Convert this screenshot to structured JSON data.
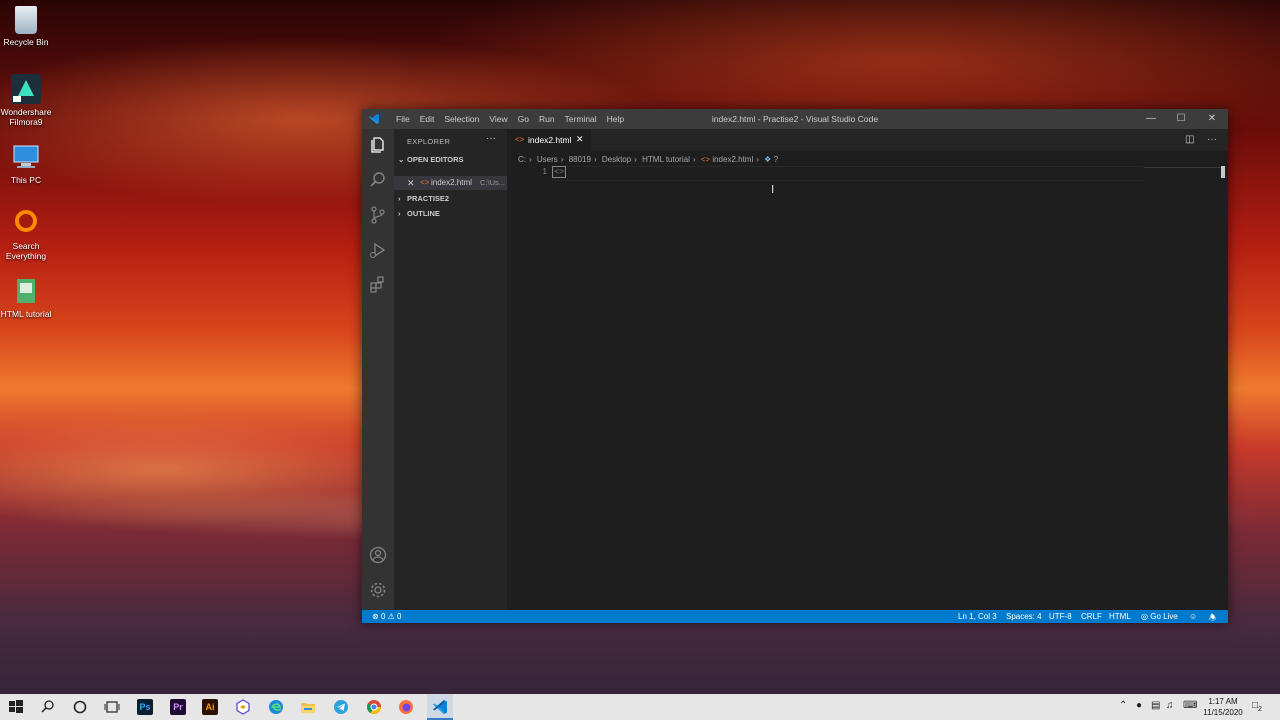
{
  "desktop": {
    "icons": [
      {
        "label": "Recycle Bin"
      },
      {
        "label": "Wondershare Filmora9"
      },
      {
        "label": "This PC"
      },
      {
        "label": "Search Everything"
      },
      {
        "label": "HTML tutorial"
      }
    ]
  },
  "window": {
    "title": "index2.html - Practise2 - Visual Studio Code",
    "menu": [
      "File",
      "Edit",
      "Selection",
      "View",
      "Go",
      "Run",
      "Terminal",
      "Help"
    ]
  },
  "sidebar": {
    "header": "EXPLORER",
    "more": "···",
    "open_editors_label": "OPEN EDITORS",
    "open_file_name": "index2.html",
    "open_file_path": "C:\\Us...",
    "project_label": "PRACTISE2",
    "outline_label": "OUTLINE"
  },
  "editor": {
    "tab_label": "index2.html",
    "breadcrumbs": [
      "C:",
      "Users",
      "88019",
      "Desktop",
      "HTML tutorial",
      "index2.html",
      "?"
    ],
    "line_number": "1",
    "line_content": "<>"
  },
  "statusbar": {
    "errors": "0",
    "warnings": "0",
    "position": "Ln 1, Col 3",
    "spaces": "Spaces: 4",
    "encoding": "UTF-8",
    "eol": "CRLF",
    "language": "HTML",
    "golive": "Go Live"
  },
  "taskbar": {
    "time": "1:17 AM",
    "date": "11/15/2020",
    "notifications": "2",
    "apps": [
      "Ps",
      "Pr",
      "Ai"
    ]
  },
  "colors": {
    "accent": "#007acc",
    "titlebar": "#3c3c3c",
    "sidebar": "#252526",
    "editor": "#1e1e1e"
  }
}
